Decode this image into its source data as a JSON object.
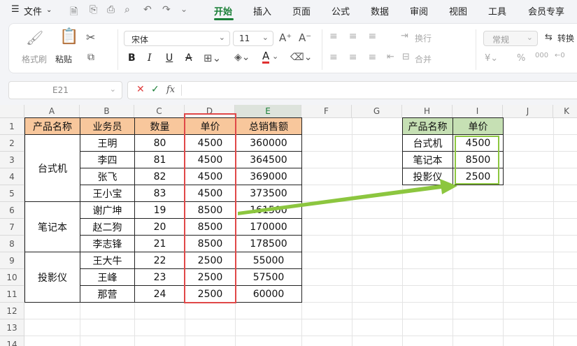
{
  "menubar": {
    "file": "文件",
    "tabs": [
      "开始",
      "插入",
      "页面",
      "公式",
      "数据",
      "审阅",
      "视图",
      "工具",
      "会员专享"
    ]
  },
  "ribbon": {
    "format_painter": "格式刷",
    "paste": "粘贴",
    "font_name": "宋体",
    "font_size": "11",
    "number_format": "常规",
    "wrap": "换行",
    "merge": "合并",
    "convert": "转换"
  },
  "formula_bar": {
    "cell_ref": "E21",
    "fx": "fx",
    "value": ""
  },
  "sheet": {
    "columns": [
      "A",
      "B",
      "C",
      "D",
      "E",
      "F",
      "G",
      "H",
      "I",
      "J",
      "K"
    ],
    "rows": [
      "1",
      "2",
      "3",
      "4",
      "5",
      "6",
      "7",
      "8",
      "9",
      "10",
      "11",
      "12",
      "13",
      "14"
    ],
    "left_table": {
      "headers": [
        "产品名称",
        "业务员",
        "数量",
        "单价",
        "总销售额"
      ],
      "groups": [
        "台式机",
        "笔记本",
        "投影仪"
      ],
      "data": [
        [
          "王明",
          "80",
          "4500",
          "360000"
        ],
        [
          "李四",
          "81",
          "4500",
          "364500"
        ],
        [
          "张飞",
          "82",
          "4500",
          "369000"
        ],
        [
          "王小宝",
          "83",
          "4500",
          "373500"
        ],
        [
          "谢广坤",
          "19",
          "8500",
          "161500"
        ],
        [
          "赵二狗",
          "20",
          "8500",
          "170000"
        ],
        [
          "李志锋",
          "21",
          "8500",
          "178500"
        ],
        [
          "王大牛",
          "22",
          "2500",
          "55000"
        ],
        [
          "王峰",
          "23",
          "2500",
          "57500"
        ],
        [
          "那营",
          "24",
          "2500",
          "60000"
        ]
      ]
    },
    "right_table": {
      "headers": [
        "产品名称",
        "单价"
      ],
      "rows": [
        [
          "台式机",
          "4500"
        ],
        [
          "笔记本",
          "8500"
        ],
        [
          "投影仪",
          "2500"
        ]
      ]
    }
  },
  "colors": {
    "accent": "#1a7f37",
    "highlight_red": "#e04040",
    "highlight_green": "#8cc63f",
    "header_orange": "#f8c79c",
    "header_green": "#c6e0b4"
  }
}
